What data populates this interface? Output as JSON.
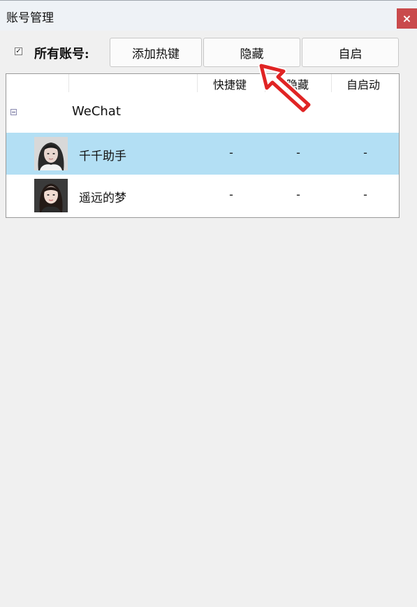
{
  "window": {
    "title": "账号管理",
    "close_symbol": "×"
  },
  "toolbar": {
    "select_all_checked": true,
    "select_all_check_symbol": "☑",
    "all_accounts_label": "所有账号:",
    "add_hotkey_label": "添加热键",
    "hide_label": "隐藏",
    "autostart_label": "自启"
  },
  "table": {
    "headers": [
      "快捷键",
      "隐藏",
      "自启动"
    ],
    "group": {
      "name": "WeChat",
      "expanded": true
    },
    "rows": [
      {
        "name": "千千助手",
        "hotkey": "-",
        "hidden": "-",
        "autostart": "-",
        "selected": true
      },
      {
        "name": "遥远的梦",
        "hotkey": "-",
        "hidden": "-",
        "autostart": "-",
        "selected": false
      }
    ]
  },
  "colors": {
    "selected_row": "#b3dff4",
    "close_button": "#c94a4c",
    "annotation_arrow": "#e02424"
  },
  "icons": {
    "close": "close-icon",
    "group_toggle": "collapse-minus-icon",
    "annotation": "red-arrow-pointer-icon"
  }
}
